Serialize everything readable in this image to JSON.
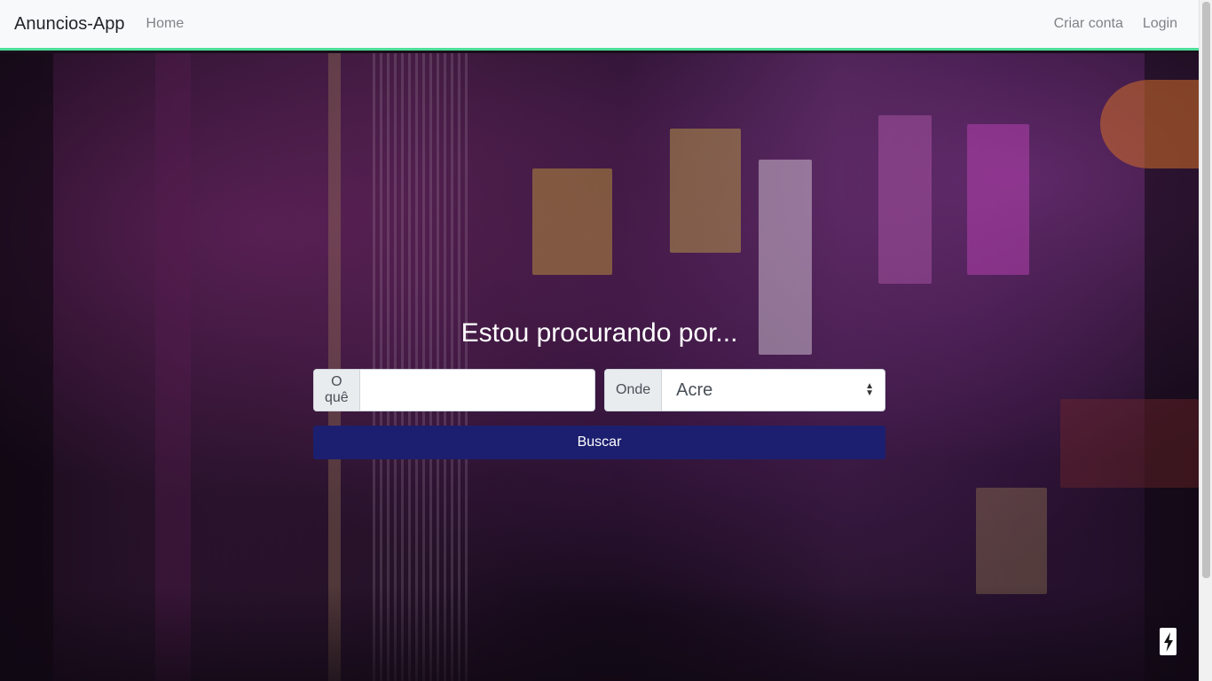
{
  "navbar": {
    "brand": "Anuncios-App",
    "home": "Home",
    "signup": "Criar conta",
    "login": "Login"
  },
  "search": {
    "headline": "Estou procurando por...",
    "what_label": "O quê",
    "what_value": "",
    "where_label": "Onde",
    "where_value": "Acre",
    "submit_label": "Buscar"
  },
  "colors": {
    "accent_border": "#4ddf9a",
    "button": "#1c1f6f"
  },
  "icons": {
    "floating_button": "lightning-bolt-icon"
  }
}
